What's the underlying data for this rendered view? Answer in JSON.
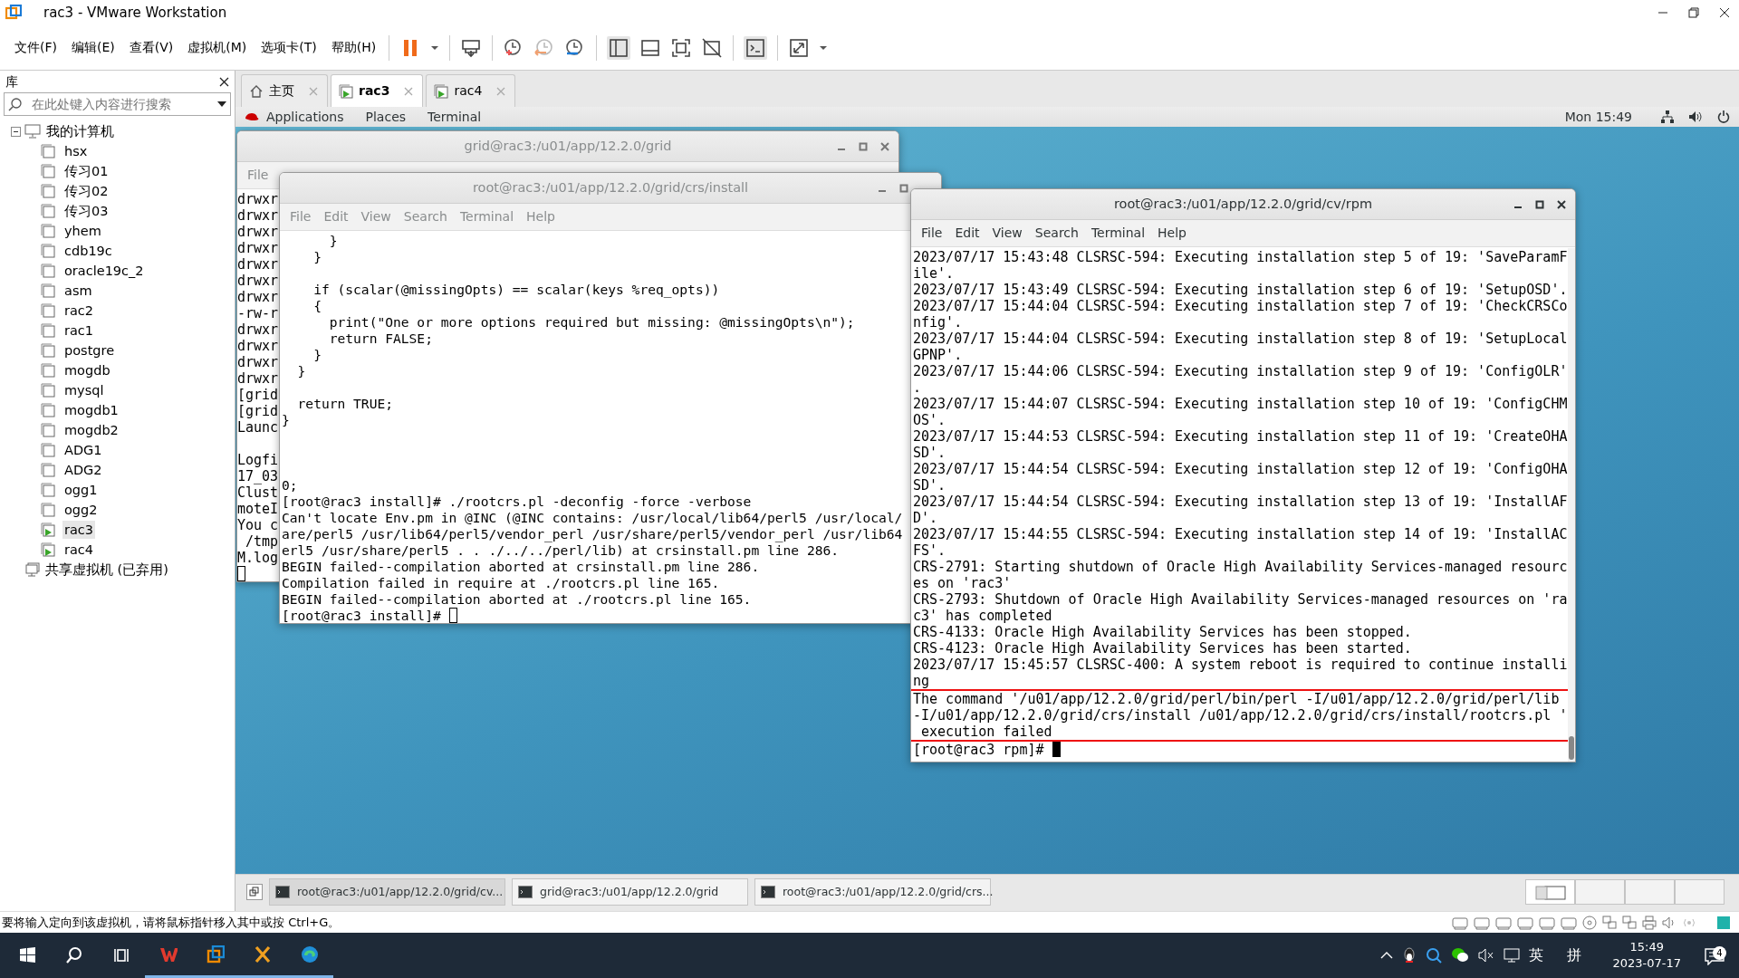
{
  "window": {
    "title": "rac3 - VMware Workstation"
  },
  "menu": [
    "文件(F)",
    "编辑(E)",
    "查看(V)",
    "虚拟机(M)",
    "选项卡(T)",
    "帮助(H)"
  ],
  "library": {
    "title": "库",
    "search": {
      "placeholder": "在此处键入内容进行搜索"
    },
    "tree": [
      {
        "label": "我的计算机",
        "kind": "computer",
        "expanded": true,
        "children": [
          {
            "label": "hsx",
            "running": false,
            "selected": false
          },
          {
            "label": "传习01",
            "running": false,
            "selected": false
          },
          {
            "label": "传习02",
            "running": false,
            "selected": false
          },
          {
            "label": "传习03",
            "running": false,
            "selected": false
          },
          {
            "label": "yhem",
            "running": false,
            "selected": false
          },
          {
            "label": "cdb19c",
            "running": false,
            "selected": false
          },
          {
            "label": "oracle19c_2",
            "running": false,
            "selected": false
          },
          {
            "label": "asm",
            "running": false,
            "selected": false
          },
          {
            "label": "rac2",
            "running": false,
            "selected": false
          },
          {
            "label": "rac1",
            "running": false,
            "selected": false
          },
          {
            "label": "postgre",
            "running": false,
            "selected": false
          },
          {
            "label": "mogdb",
            "running": false,
            "selected": false
          },
          {
            "label": "mysql",
            "running": false,
            "selected": false
          },
          {
            "label": "mogdb1",
            "running": false,
            "selected": false
          },
          {
            "label": "mogdb2",
            "running": false,
            "selected": false
          },
          {
            "label": "ADG1",
            "running": false,
            "selected": false
          },
          {
            "label": "ADG2",
            "running": false,
            "selected": false
          },
          {
            "label": "ogg1",
            "running": false,
            "selected": false
          },
          {
            "label": "ogg2",
            "running": false,
            "selected": false
          },
          {
            "label": "rac3",
            "running": true,
            "selected": true
          },
          {
            "label": "rac4",
            "running": true,
            "selected": false
          }
        ]
      },
      {
        "label": "共享虚拟机 (已弃用)",
        "kind": "shared"
      }
    ]
  },
  "tabs": [
    {
      "label": "主页",
      "kind": "home",
      "selected": false
    },
    {
      "label": "rac3",
      "kind": "vm",
      "selected": true
    },
    {
      "label": "rac4",
      "kind": "vm",
      "selected": false
    }
  ],
  "guest": {
    "top_bar": {
      "menus": [
        "Applications",
        "Places",
        "Terminal"
      ],
      "clock": "Mon 15:49"
    },
    "windows": [
      {
        "title": "grid@rac3:/u01/app/12.2.0/grid",
        "active": false,
        "menus": [
          "File"
        ],
        "cursor_filled": false,
        "lines": [
          {
            "kind": "text",
            "text": "drwxr"
          },
          {
            "kind": "text",
            "text": "drwxr"
          },
          {
            "kind": "text",
            "text": "drwxr"
          },
          {
            "kind": "text",
            "text": "drwxr"
          },
          {
            "kind": "text",
            "text": "drwxr"
          },
          {
            "kind": "text",
            "text": "drwxr"
          },
          {
            "kind": "text",
            "text": "drwxr"
          },
          {
            "kind": "text",
            "text": "-rw-r"
          },
          {
            "kind": "text",
            "text": "drwxr"
          },
          {
            "kind": "text",
            "text": "drwxr"
          },
          {
            "kind": "text",
            "text": "drwxr"
          },
          {
            "kind": "text",
            "text": "drwxr"
          },
          {
            "kind": "text",
            "text": "[grid"
          },
          {
            "kind": "text",
            "text": "[grid"
          },
          {
            "kind": "text",
            "text": "Launc"
          },
          {
            "kind": "blank"
          },
          {
            "kind": "text",
            "text": "Logfi"
          },
          {
            "kind": "text",
            "text": "17_03"
          },
          {
            "kind": "text",
            "text": "Clust"
          },
          {
            "kind": "text",
            "text": "moteI"
          },
          {
            "kind": "text",
            "text": "You c"
          },
          {
            "kind": "text",
            "text": " /tmp"
          },
          {
            "kind": "text",
            "text": "M.log"
          },
          {
            "kind": "blank"
          }
        ]
      },
      {
        "title": "root@rac3:/u01/app/12.2.0/grid/crs/install",
        "active": false,
        "menus": [
          "File",
          "Edit",
          "View",
          "Search",
          "Terminal",
          "Help"
        ],
        "cursor_filled": false,
        "lines": [
          {
            "kind": "text",
            "text": "      }"
          },
          {
            "kind": "text",
            "text": "    }"
          },
          {
            "kind": "blank"
          },
          {
            "kind": "text",
            "text": "    if (scalar(@missingOpts) == scalar(keys %req_opts))"
          },
          {
            "kind": "text",
            "text": "    {"
          },
          {
            "kind": "text",
            "text": "      print(\"One or more options required but missing: @missingOpts\\n\");"
          },
          {
            "kind": "text",
            "text": "      return FALSE;"
          },
          {
            "kind": "text",
            "text": "    }"
          },
          {
            "kind": "text",
            "text": "  }"
          },
          {
            "kind": "blank"
          },
          {
            "kind": "text",
            "text": "  return TRUE;"
          },
          {
            "kind": "text",
            "text": "}"
          },
          {
            "kind": "blank"
          },
          {
            "kind": "blank"
          },
          {
            "kind": "blank"
          },
          {
            "kind": "text",
            "text": "0;"
          },
          {
            "kind": "text",
            "text": "[root@rac3 install]# ./rootcrs.pl -deconfig -force -verbose"
          },
          {
            "kind": "text",
            "text": "Can't locate Env.pm in @INC (@INC contains: /usr/local/lib64/perl5 /usr/local/"
          },
          {
            "kind": "text",
            "text": "are/perl5 /usr/lib64/perl5/vendor_perl /usr/share/perl5/vendor_perl /usr/lib64"
          },
          {
            "kind": "text",
            "text": "erl5 /usr/share/perl5 . . ./../../perl/lib) at crsinstall.pm line 286."
          },
          {
            "kind": "text",
            "text": "BEGIN failed--compilation aborted at crsinstall.pm line 286."
          },
          {
            "kind": "text",
            "text": "Compilation failed in require at ./rootcrs.pl line 165."
          },
          {
            "kind": "text",
            "text": "BEGIN failed--compilation aborted at ./rootcrs.pl line 165."
          },
          {
            "kind": "text",
            "text": "[root@rac3 install]#"
          }
        ]
      },
      {
        "title": "root@rac3:/u01/app/12.2.0/grid/cv/rpm",
        "active": true,
        "menus": [
          "File",
          "Edit",
          "View",
          "Search",
          "Terminal",
          "Help"
        ],
        "cursor_filled": true,
        "lines": [
          {
            "kind": "text",
            "text": "2023/07/17 15:43:48 CLSRSC-594: Executing installation step 5 of 19: 'SaveParamF"
          },
          {
            "kind": "text",
            "text": "ile'."
          },
          {
            "kind": "text",
            "text": "2023/07/17 15:43:49 CLSRSC-594: Executing installation step 6 of 19: 'SetupOSD'."
          },
          {
            "kind": "text",
            "text": "2023/07/17 15:44:04 CLSRSC-594: Executing installation step 7 of 19: 'CheckCRSCo"
          },
          {
            "kind": "text",
            "text": "nfig'."
          },
          {
            "kind": "text",
            "text": "2023/07/17 15:44:04 CLSRSC-594: Executing installation step 8 of 19: 'SetupLocal"
          },
          {
            "kind": "text",
            "text": "GPNP'."
          },
          {
            "kind": "text",
            "text": "2023/07/17 15:44:06 CLSRSC-594: Executing installation step 9 of 19: 'ConfigOLR'"
          },
          {
            "kind": "text",
            "text": "."
          },
          {
            "kind": "text",
            "text": "2023/07/17 15:44:07 CLSRSC-594: Executing installation step 10 of 19: 'ConfigCHM"
          },
          {
            "kind": "text",
            "text": "OS'."
          },
          {
            "kind": "text",
            "text": "2023/07/17 15:44:53 CLSRSC-594: Executing installation step 11 of 19: 'CreateOHA"
          },
          {
            "kind": "text",
            "text": "SD'."
          },
          {
            "kind": "text",
            "text": "2023/07/17 15:44:54 CLSRSC-594: Executing installation step 12 of 19: 'ConfigOHA"
          },
          {
            "kind": "text",
            "text": "SD'."
          },
          {
            "kind": "text",
            "text": "2023/07/17 15:44:54 CLSRSC-594: Executing installation step 13 of 19: 'InstallAF"
          },
          {
            "kind": "text",
            "text": "D'."
          },
          {
            "kind": "text",
            "text": "2023/07/17 15:44:55 CLSRSC-594: Executing installation step 14 of 19: 'InstallAC"
          },
          {
            "kind": "text",
            "text": "FS'."
          },
          {
            "kind": "text",
            "text": "CRS-2791: Starting shutdown of Oracle High Availability Services-managed resourc"
          },
          {
            "kind": "text",
            "text": "es on 'rac3'"
          },
          {
            "kind": "text",
            "text": "CRS-2793: Shutdown of Oracle High Availability Services-managed resources on 'ra"
          },
          {
            "kind": "text",
            "text": "c3' has completed"
          },
          {
            "kind": "text",
            "text": "CRS-4133: Oracle High Availability Services has been stopped."
          },
          {
            "kind": "text",
            "text": "CRS-4123: Oracle High Availability Services has been started."
          },
          {
            "kind": "text",
            "text": "2023/07/17 15:45:57 CLSRSC-400: A system reboot is required to continue installi"
          },
          {
            "kind": "text",
            "text": "ng"
          }
        ],
        "annotated_lines": [
          "The command '/u01/app/12.2.0/grid/perl/bin/perl -I/u01/app/12.2.0/grid/perl/lib",
          "-I/u01/app/12.2.0/grid/crs/install /u01/app/12.2.0/grid/crs/install/rootcrs.pl '",
          " execution failed"
        ],
        "after_lines": [
          "[root@rac3 rpm]#"
        ]
      }
    ],
    "window_list": [
      {
        "label": "root@rac3:/u01/app/12.2.0/grid/cv...",
        "selected": true
      },
      {
        "label": "grid@rac3:/u01/app/12.2.0/grid",
        "selected": false
      },
      {
        "label": "root@rac3:/u01/app/12.2.0/grid/crs...",
        "selected": false
      }
    ],
    "workspaces": [
      {
        "selected": true
      },
      {
        "selected": false
      },
      {
        "selected": false
      },
      {
        "selected": false
      }
    ]
  },
  "status_bar": {
    "text": "要将输入定向到该虚拟机，请将鼠标指针移入其中或按 Ctrl+G。"
  },
  "taskbar": {
    "ime_language": "英",
    "ime_mode": "拼",
    "time": "15:49",
    "date": "2023-07-17",
    "notification_count": "4"
  }
}
